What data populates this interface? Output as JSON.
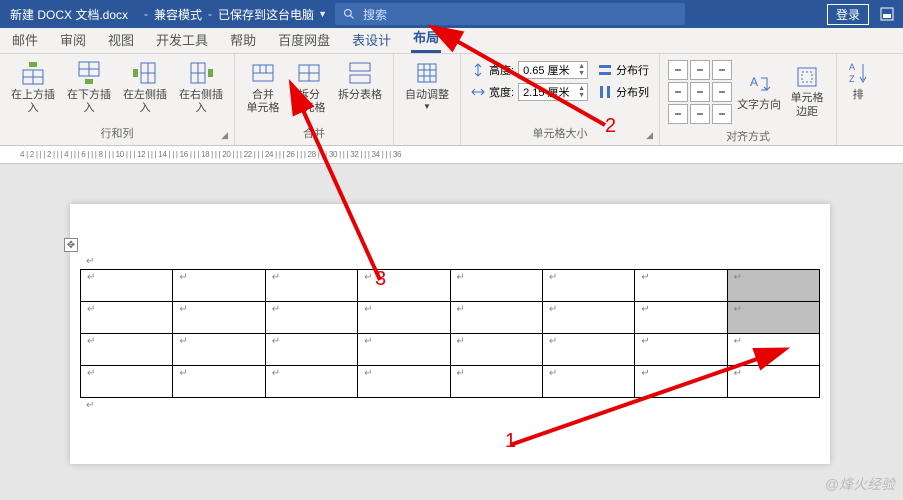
{
  "titlebar": {
    "filename": "新建 DOCX 文档.docx",
    "compat": "兼容模式",
    "saved": "已保存到这台电脑",
    "search_placeholder": "搜索",
    "login": "登录"
  },
  "tabs": {
    "t0": "邮件",
    "t1": "审阅",
    "t2": "视图",
    "t3": "开发工具",
    "t4": "帮助",
    "t5": "百度网盘",
    "t6": "表设计",
    "t7": "布局"
  },
  "ribbon": {
    "insert_above": "在上方插入",
    "insert_below": "在下方插入",
    "insert_left": "在左侧插入",
    "insert_right": "在右侧插入",
    "rows_cols_group": "行和列",
    "merge_cells": "合并\n单元格",
    "split_cells": "拆分\n单元格",
    "split_table": "拆分表格",
    "merge_group": "合并",
    "autofit": "自动调整",
    "height_label": "高度:",
    "height_val": "0.65 厘米",
    "width_label": "宽度:",
    "width_val": "2.15 厘米",
    "size_group": "单元格大小",
    "dist_rows": "分布行",
    "dist_cols": "分布列",
    "text_dir": "文字方向",
    "cell_margins": "单元格\n边距",
    "align_group": "对齐方式",
    "sort": "排"
  },
  "ruler_text": "4 | 2 | | | 2 | | | 4 | | | 6 | | | 8 | | | 10 | | | 12 | | | 14 | | | 16 | | | 18 | | | 20 | | | 22 | | | 24 | | | 26 | | | 28 | | | 30 | | | 32 | | | 34 | | | 36",
  "annotations": {
    "n1": "1",
    "n2": "2",
    "n3": "3"
  },
  "cellmark": "↵",
  "watermark": "@烽火经验"
}
